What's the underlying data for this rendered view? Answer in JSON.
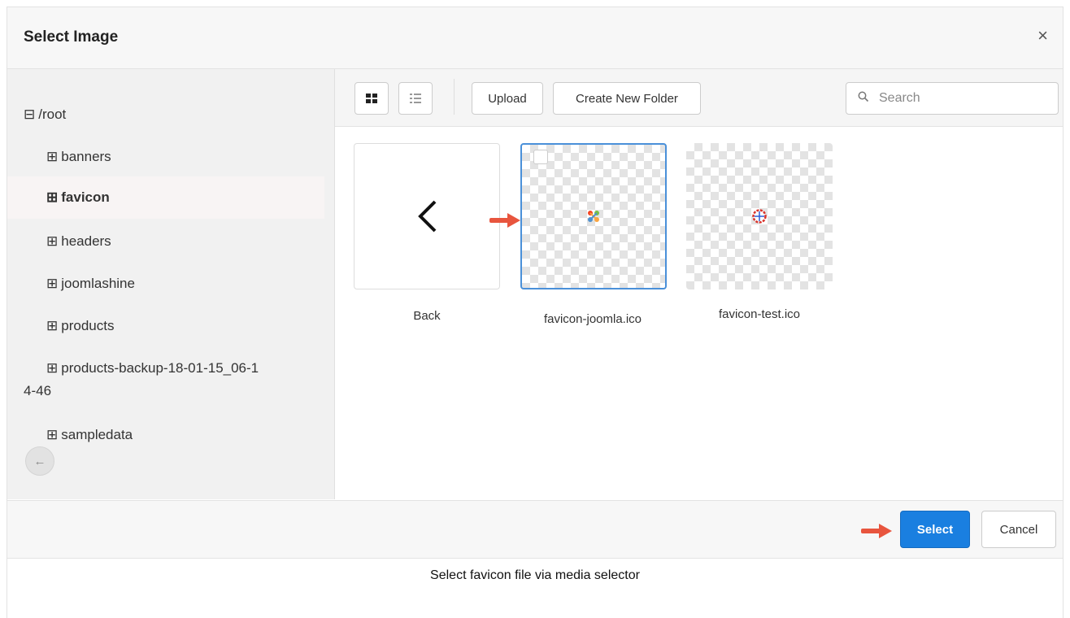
{
  "dialog": {
    "title": "Select Image",
    "close_label": "×"
  },
  "sidebar": {
    "root": "/root",
    "folders": [
      {
        "label": "banners"
      },
      {
        "label": "favicon"
      },
      {
        "label": "headers"
      },
      {
        "label": "joomlashine"
      },
      {
        "label": "products"
      },
      {
        "label": "products-backup-18-01-15_06-1",
        "label_line2": "4-46"
      },
      {
        "label": "sampledata"
      }
    ],
    "selected_folder": "favicon",
    "back_icon": "arrow-left-icon"
  },
  "toolbar": {
    "grid_view_icon": "grid-view-icon",
    "list_view_icon": "list-view-icon",
    "upload_label": "Upload",
    "create_folder_label": "Create New Folder",
    "search_placeholder": "Search"
  },
  "files": [
    {
      "label": "Back",
      "icon": "chevron-left-icon"
    },
    {
      "label": "favicon-joomla.ico",
      "selected": true
    },
    {
      "label": "favicon-test.ico"
    }
  ],
  "footer": {
    "select_label": "Select",
    "cancel_label": "Cancel"
  },
  "caption": "Select favicon file via media selector",
  "colors": {
    "accent": "#1a7fe0",
    "selection_border": "#4a90d9",
    "annotation_arrow": "#e8553e"
  }
}
